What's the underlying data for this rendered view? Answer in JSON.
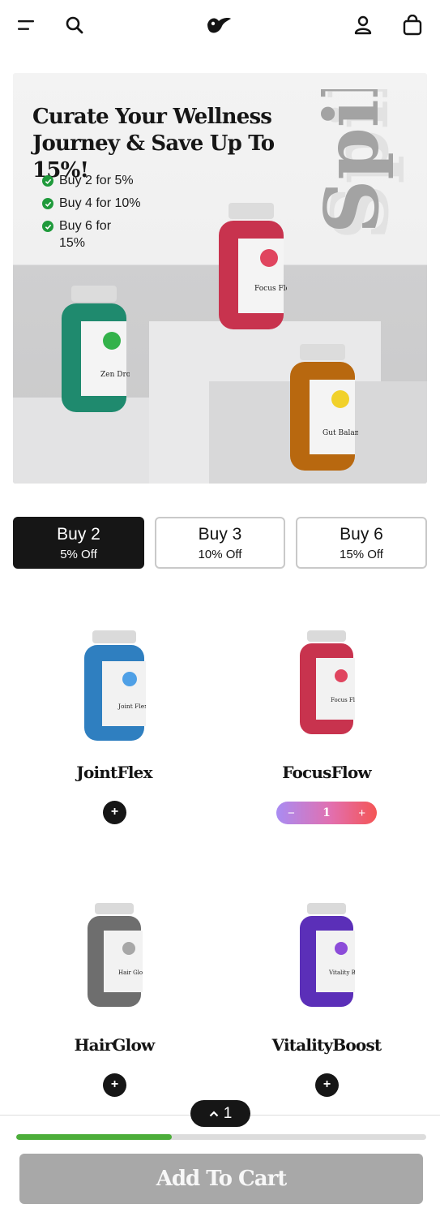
{
  "header": {
    "icons": [
      "menu-icon",
      "search-icon",
      "bird-logo-icon",
      "account-icon",
      "bag-icon"
    ]
  },
  "hero": {
    "title": "Curate Your Wellness Journey & Save Up To 15%!",
    "tiers": [
      "Buy 2 for 5%",
      "Buy 4 for 10%",
      "Buy 6 for 15%"
    ],
    "brand_mark": "Spill",
    "bottles": [
      {
        "label": "Zen Drops",
        "color": "#1f8a6e"
      },
      {
        "label": "Focus Flow",
        "color": "#c8334e"
      },
      {
        "label": "Gut Balance",
        "color": "#b8680f"
      }
    ]
  },
  "bundle_tabs": [
    {
      "title": "Buy 2",
      "sub": "5% Off",
      "active": true
    },
    {
      "title": "Buy 3",
      "sub": "10% Off",
      "active": false
    },
    {
      "title": "Buy 6",
      "sub": "15% Off",
      "active": false
    }
  ],
  "products": [
    {
      "name": "JointFlex",
      "label": "Joint Flex",
      "color": "#2f7fc0",
      "accent": "#4fa0e6",
      "add": "+"
    },
    {
      "name": "FocusFlow",
      "label": "Focus Flow",
      "color": "#c8334e",
      "accent": "#e0455f",
      "stepper": {
        "minus": "−",
        "qty": "1",
        "plus": "+"
      }
    },
    {
      "name": "HairGlow",
      "label": "Hair Glow",
      "color": "#6e6e6e",
      "accent": "#a7a7a7",
      "add": "+"
    },
    {
      "name": "VitalityBoost",
      "label": "Vitality Boost",
      "color": "#5b2fb8",
      "accent": "#8c4cd9",
      "add": "+"
    }
  ],
  "footer": {
    "selected_count": "1",
    "progress": 0.38,
    "progress_color": "#4cae3a",
    "cart_label": "Add To Cart"
  }
}
